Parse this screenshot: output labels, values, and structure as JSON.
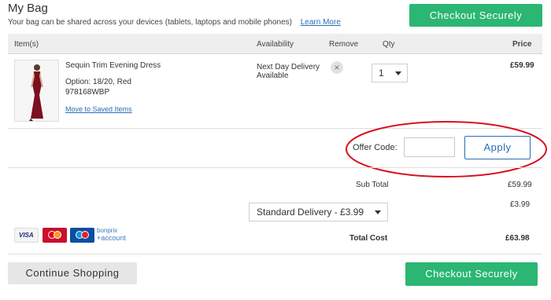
{
  "page": {
    "title": "My Bag",
    "subtitle": "Your bag can be shared across your devices (tablets, laptops and mobile phones)",
    "learn_more": "Learn More",
    "checkout_label": "Checkout Securely",
    "continue_label": "Continue Shopping"
  },
  "table_headers": {
    "items": "Item(s)",
    "availability": "Availability",
    "remove": "Remove",
    "qty": "Qty",
    "price": "Price"
  },
  "item": {
    "name": "Sequin Trim Evening Dress",
    "option": "Option: 18/20, Red",
    "sku": "978168WBP",
    "move_link": "Move to Saved Items",
    "availability_line1": "Next Day Delivery",
    "availability_line2": "Available",
    "remove_icon": "×",
    "qty": "1",
    "price": "£59.99"
  },
  "offer": {
    "label": "Offer Code:",
    "value": "",
    "apply_label": "Apply"
  },
  "totals": {
    "subtotal_label": "Sub Total",
    "subtotal_value": "£59.99",
    "delivery_option": "Standard Delivery - £3.99",
    "delivery_value": "£3.99",
    "total_label": "Total Cost",
    "total_value": "£63.98"
  },
  "payment": {
    "visa": "VISA",
    "bonprix_top": "bonprix",
    "bonprix_bottom": "+account"
  },
  "colors": {
    "accent_green": "#2bb673",
    "link_blue": "#2a6db5",
    "annotation_red": "#d8101e"
  }
}
